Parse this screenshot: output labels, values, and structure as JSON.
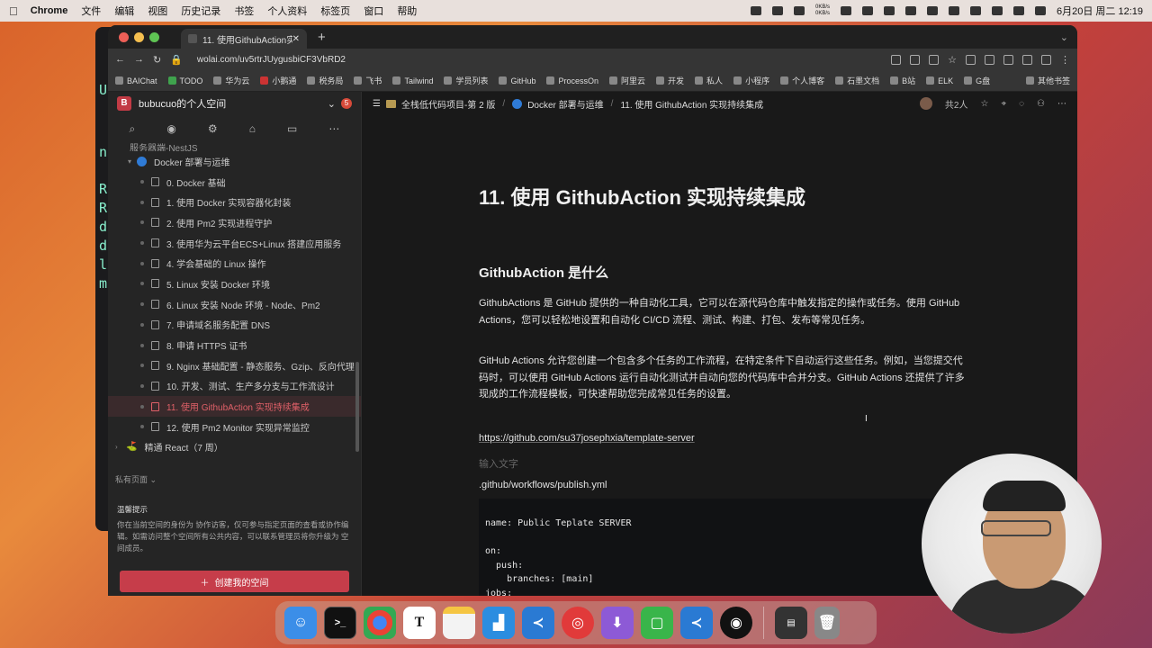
{
  "menubar": {
    "app": "Chrome",
    "items": [
      "文件",
      "编辑",
      "视图",
      "历史记录",
      "书签",
      "个人资料",
      "标签页",
      "窗口",
      "帮助"
    ],
    "net_up": "0KB/s",
    "net_down": "0KB/s",
    "clock": "6月20日 周二 12:19"
  },
  "background_terminal": {
    "lines": [
      "U",
      "n",
      "R",
      "R",
      "d",
      "d",
      "l",
      "m"
    ]
  },
  "browser": {
    "tab_title": "11. 使用GithubAction实现持续",
    "url": "wolai.com/uv5rtrJUygusbiCF3VbRD2",
    "bookmarks": [
      "BAIChat",
      "TODO",
      "华为云",
      "小鹅通",
      "税务局",
      "飞书",
      "Tailwind",
      "学员列表",
      "GitHub",
      "ProcessOn",
      "阿里云",
      "开发",
      "私人",
      "小程序",
      "个人博客",
      "石墨文档",
      "B站",
      "ELK",
      "G盘"
    ],
    "other_bookmarks": "其他书签"
  },
  "sidebar": {
    "space_name": "bubucuo的个人空间",
    "badge": "5",
    "partial_item": "服务器端-NestJS",
    "section": "Docker 部署与运维",
    "items": [
      "0. Docker 基础",
      "1. 使用 Docker 实现容器化封装",
      "2. 使用 Pm2 实现进程守护",
      "3. 使用华为云平台ECS+Linux 搭建应用服务",
      "4. 学会基础的 Linux 操作",
      "5. Linux 安装 Docker 环境",
      "6. Linux 安装 Node 环境 - Node、Pm2",
      "7. 申请域名服务配置 DNS",
      "8. 申请 HTTPS 证书",
      "9. Nginx 基础配置 - 静态服务、Gzip、反向代理",
      "10. 开发、测试、生产多分支与工作流设计",
      "11. 使用 GithubAction 实现持续集成",
      "12. 使用 Pm2 Monitor 实现异常监控"
    ],
    "next_section": "精通 React（7 周）",
    "private_pages": "私有页面",
    "tips_title": "温馨提示",
    "tips_text": "你在当前空间的身份为 协作访客，仅可参与指定页面的查看或协作编辑。如需访问整个空间所有公共内容，可以联系管理员将你升级为 空间成员。",
    "create_button": "创建我的空间"
  },
  "topnav": {
    "crumbs": [
      "全栈低代码项目-第 2 版",
      "Docker 部署与运维",
      "11. 使用 GithubAction 实现持续集成"
    ],
    "people": "共2人"
  },
  "doc": {
    "title": "11. 使用 GithubAction 实现持续集成",
    "h2": "GithubAction 是什么",
    "p1": "GithubActions 是 GitHub 提供的一种自动化工具，它可以在源代码仓库中触发指定的操作或任务。使用 GitHub Actions，您可以轻松地设置和自动化 CI/CD 流程、测试、构建、打包、发布等常见任务。",
    "p2": "GitHub Actions 允许您创建一个包含多个任务的工作流程，在特定条件下自动运行这些任务。例如，当您提交代码时，可以使用 GitHub Actions 运行自动化测试并自动向您的代码库中合并分支。GitHub Actions 还提供了许多现成的工作流程模板，可快速帮助您完成常见任务的设置。",
    "link": "https://github.com/su37josephxia/template-server",
    "placeholder": "输入文字",
    "path": ".github/workflows/publish.yml",
    "code": "name: Public Teplate SERVER\n\non:\n  push:\n    branches: [main]\njobs:"
  }
}
